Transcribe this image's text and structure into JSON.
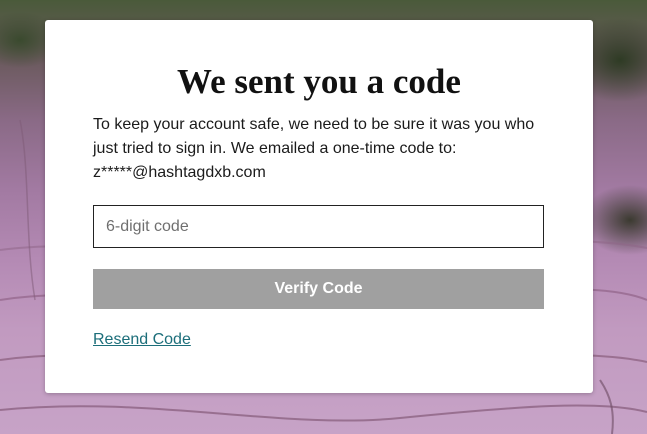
{
  "dialog": {
    "title": "We sent you a code",
    "message_line1": "To keep your account safe, we need to be sure it was you who",
    "message_line2": "just tried to sign in. We emailed a one-time code to:",
    "email": "z*****@hashtagdxb.com",
    "code_input": {
      "placeholder": "6-digit code",
      "value": ""
    },
    "verify_label": "Verify Code",
    "resend_label": "Resend Code"
  },
  "colors": {
    "button_bg": "#a0a0a0",
    "link": "#1c6e7a",
    "card_bg": "#ffffff"
  }
}
